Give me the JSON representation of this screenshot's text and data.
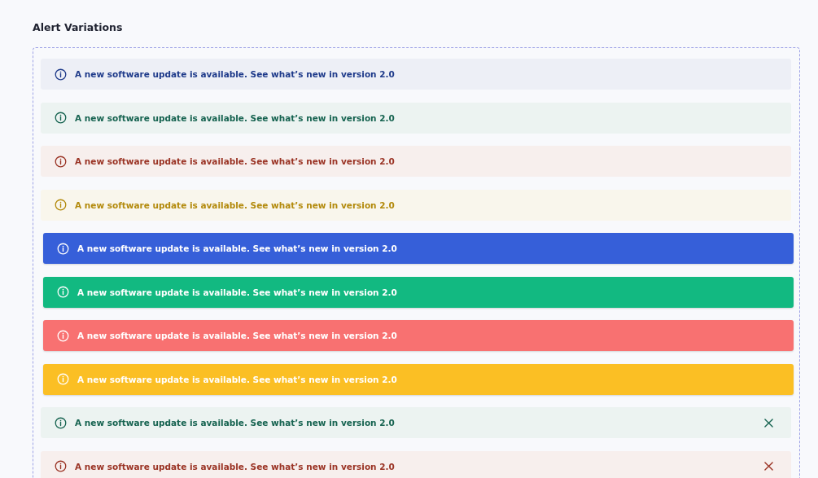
{
  "title": "Alert Variations",
  "alerts": [
    {
      "kind": "soft",
      "color": "#1e3a8a",
      "text": "A new software update is available. See what’s new in version 2.0",
      "dismissible": false
    },
    {
      "kind": "soft",
      "color": "#166350",
      "text": "A new software update is available. See what’s new in version 2.0",
      "dismissible": false
    },
    {
      "kind": "soft",
      "color": "#9a3324",
      "text": "A new software update is available. See what’s new in version 2.0",
      "dismissible": false
    },
    {
      "kind": "soft",
      "color": "#b38a0c",
      "text": "A new software update is available. See what’s new in version 2.0",
      "dismissible": false
    },
    {
      "kind": "solid",
      "color": "#365fd9",
      "text": "A new software update is available. See what’s new in version 2.0",
      "dismissible": false
    },
    {
      "kind": "solid",
      "color": "#12b981",
      "text": "A new software update is available. See what’s new in version 2.0",
      "dismissible": false
    },
    {
      "kind": "solid",
      "color": "#f87171",
      "text": "A new software update is available. See what’s new in version 2.0",
      "dismissible": false
    },
    {
      "kind": "solid",
      "color": "#fbbf24",
      "text": "A new software update is available. See what’s new in version 2.0",
      "dismissible": false
    },
    {
      "kind": "soft",
      "color": "#166350",
      "text": "A new software update is available. See what’s new in version 2.0",
      "dismissible": true
    },
    {
      "kind": "soft",
      "color": "#9a3324",
      "text": "A new software update is available. See what’s new in version 2.0",
      "dismissible": true
    }
  ]
}
